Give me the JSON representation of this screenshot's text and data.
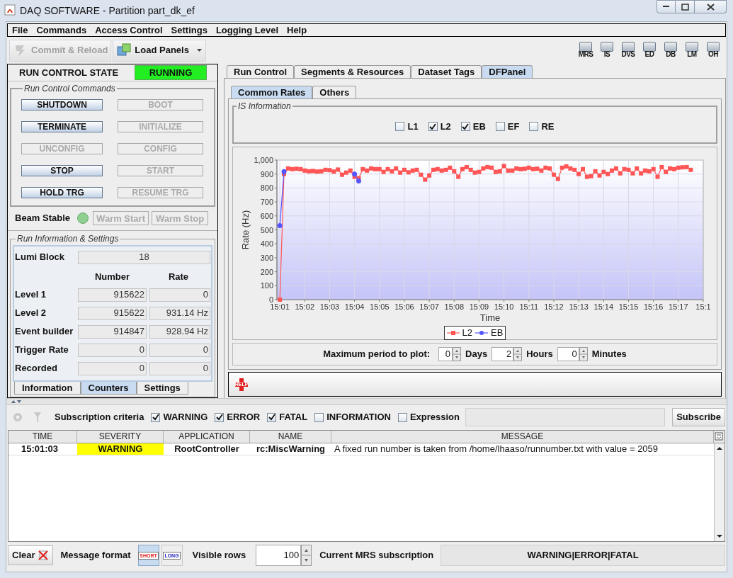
{
  "window": {
    "title": "DAQ SOFTWARE - Partition part_dk_ef"
  },
  "menu": [
    "File",
    "Commands",
    "Access Control",
    "Settings",
    "Logging Level",
    "Help"
  ],
  "toolbar": {
    "buttons": [
      {
        "label": "Commit & Reload",
        "disabled": true
      },
      {
        "label": "Load Panels",
        "disabled": false
      }
    ],
    "tools": [
      "MRS",
      "IS",
      "DVS",
      "ED",
      "DB",
      "LM",
      "OH"
    ]
  },
  "run_control": {
    "title": "RUN CONTROL STATE",
    "state": "RUNNING",
    "commands_title": "Run Control Commands",
    "commands": [
      {
        "label": "SHUTDOWN",
        "disabled": false
      },
      {
        "label": "BOOT",
        "disabled": true
      },
      {
        "label": "TERMINATE",
        "disabled": false
      },
      {
        "label": "INITIALIZE",
        "disabled": true
      },
      {
        "label": "UNCONFIG",
        "disabled": true
      },
      {
        "label": "CONFIG",
        "disabled": true
      },
      {
        "label": "STOP",
        "disabled": false
      },
      {
        "label": "START",
        "disabled": true
      },
      {
        "label": "HOLD TRG",
        "disabled": false
      },
      {
        "label": "RESUME TRG",
        "disabled": true
      }
    ],
    "beam_label": "Beam Stable",
    "beam_buttons": [
      {
        "label": "Warm Start",
        "disabled": true
      },
      {
        "label": "Warm Stop",
        "disabled": true
      }
    ]
  },
  "run_info": {
    "title": "Run Information & Settings",
    "lumi_label": "Lumi Block",
    "lumi": "18",
    "columns": [
      "Number",
      "Rate"
    ],
    "rows": [
      {
        "label": "Level 1",
        "number": "915622",
        "rate": "0"
      },
      {
        "label": "Level 2",
        "number": "915622",
        "rate": "931.14 Hz"
      },
      {
        "label": "Event builder",
        "number": "914847",
        "rate": "928.94 Hz"
      },
      {
        "label": "Trigger Rate",
        "number": "0",
        "rate": "0"
      },
      {
        "label": "Recorded",
        "number": "0",
        "rate": "0"
      }
    ],
    "tabs": [
      {
        "label": "Information",
        "selected": false
      },
      {
        "label": "Counters",
        "selected": true
      },
      {
        "label": "Settings",
        "selected": false
      }
    ]
  },
  "main_tabs": [
    {
      "label": "Run Control",
      "selected": false
    },
    {
      "label": "Segments & Resources",
      "selected": false
    },
    {
      "label": "Dataset Tags",
      "selected": false
    },
    {
      "label": "DFPanel",
      "selected": true
    }
  ],
  "sub_tabs": [
    {
      "label": "Common Rates",
      "selected": true
    },
    {
      "label": "Others",
      "selected": false
    }
  ],
  "is_info": {
    "title": "IS Information",
    "checks": [
      {
        "label": "L1",
        "checked": false
      },
      {
        "label": "L2",
        "checked": true
      },
      {
        "label": "EB",
        "checked": true
      },
      {
        "label": "EF",
        "checked": false
      },
      {
        "label": "RE",
        "checked": false
      }
    ]
  },
  "chart_data": {
    "type": "line",
    "xlabel": "Time",
    "ylabel": "Rate (Hz)",
    "categories": [
      "15:01",
      null,
      null,
      null,
      null,
      null,
      "15:02",
      null,
      null,
      null,
      null,
      null,
      "15:03",
      null,
      null,
      null,
      null,
      null,
      "15:04",
      null,
      null,
      null,
      null,
      null,
      "15:05",
      null,
      null,
      null,
      null,
      null,
      "15:06",
      null,
      null,
      null,
      null,
      null,
      "15:07",
      null,
      null,
      null,
      null,
      null,
      "15:08",
      null,
      null,
      null,
      null,
      null,
      "15:09",
      null,
      null,
      null,
      null,
      null,
      "15:10",
      null,
      null,
      null,
      null,
      null,
      "15:11",
      null,
      null,
      null,
      null,
      null,
      "15:12",
      null,
      null,
      null,
      null,
      null,
      "15:13",
      null,
      null,
      null,
      null,
      null,
      "15:14",
      null,
      null,
      null,
      null,
      null,
      "15:15",
      null,
      null,
      null,
      null,
      null,
      "15:16",
      null,
      null,
      null,
      null,
      null,
      "15:17",
      null,
      null,
      null,
      null,
      null,
      "15:1"
    ],
    "series": [
      {
        "name": "L2",
        "color": "#ff5555",
        "marker": "square",
        "values": [
          0,
          900,
          940,
          935,
          938,
          935,
          925,
          920,
          922,
          918,
          920,
          930,
          928,
          918,
          932,
          895,
          910,
          925,
          880,
          870,
          935,
          925,
          940,
          935,
          935,
          915,
          935,
          920,
          940,
          910,
          930,
          912,
          925,
          930,
          895,
          860,
          890,
          930,
          935,
          925,
          930,
          945,
          920,
          880,
          935,
          950,
          930,
          910,
          915,
          940,
          950,
          945,
          915,
          920,
          958,
          925,
          925,
          940,
          935,
          938,
          945,
          935,
          938,
          925,
          945,
          940,
          895,
          865,
          945,
          955,
          940,
          930,
          900,
          935,
          880,
          885,
          920,
          890,
          915,
          900,
          925,
          940,
          905,
          935,
          930,
          905,
          940,
          905,
          925,
          920,
          935,
          880,
          950,
          915,
          940,
          935,
          945,
          948,
          950,
          930,
          null,
          null,
          null
        ]
      },
      {
        "name": "EB",
        "color": "#5555ff",
        "marker": "circle",
        "values": [
          530,
          918,
          null,
          null,
          null,
          null,
          null,
          null,
          null,
          null,
          null,
          null,
          null,
          null,
          null,
          null,
          null,
          null,
          900,
          850,
          null,
          null,
          null,
          null,
          null,
          null,
          null,
          null,
          null,
          null,
          null,
          null,
          null,
          null,
          null,
          null,
          null,
          null,
          null,
          null,
          null,
          null,
          null,
          null,
          null,
          null,
          null,
          null,
          null,
          null,
          null,
          null,
          null,
          null,
          null,
          null,
          null,
          null,
          null,
          null,
          null,
          null,
          null,
          null,
          null,
          null,
          null,
          null,
          null,
          null,
          null,
          null,
          null,
          null,
          null,
          null,
          null,
          null,
          null,
          null,
          null,
          null,
          null,
          null,
          null,
          null,
          null,
          null,
          null,
          null,
          null,
          null,
          null,
          null,
          null,
          null,
          null,
          null,
          null,
          null,
          null,
          null,
          null
        ]
      }
    ],
    "ylim": [
      0,
      1000
    ],
    "grid": true,
    "legend": true,
    "yticks": [
      0,
      100,
      200,
      300,
      400,
      500,
      600,
      700,
      800,
      900,
      {
        "value": 1000,
        "label": "1,000"
      }
    ]
  },
  "period": {
    "label": "Maximum period to plot:",
    "fields": [
      {
        "value": "0",
        "unit": "Days"
      },
      {
        "value": "2",
        "unit": "Hours"
      },
      {
        "value": "0",
        "unit": "Minutes"
      }
    ]
  },
  "help": "HELP",
  "messages": {
    "criteria_label": "Subscription criteria",
    "filters": [
      {
        "label": "WARNING",
        "checked": true
      },
      {
        "label": "ERROR",
        "checked": true
      },
      {
        "label": "FATAL",
        "checked": true
      },
      {
        "label": "INFORMATION",
        "checked": false
      },
      {
        "label": "Expression",
        "checked": false
      }
    ],
    "subscribe": "Subscribe",
    "columns": [
      "TIME",
      "SEVERITY",
      "APPLICATION",
      "NAME",
      "MESSAGE"
    ],
    "rows": [
      {
        "time": "15:01:03",
        "severity": "WARNING",
        "color": "#ffff00",
        "application": "RootController",
        "name": "rc:MiscWarning",
        "message": "A fixed run number is taken from /home/lhaaso/runnumber.txt with value = 2059"
      }
    ]
  },
  "footer": {
    "clear": "Clear",
    "format_label": "Message format",
    "formats": [
      {
        "label": "SHORT",
        "selected": true
      },
      {
        "label": "LONG",
        "selected": false
      }
    ],
    "rows_label": "Visible rows",
    "rows_value": "100",
    "subscription_label": "Current MRS subscription",
    "subscription": "WARNING|ERROR|FATAL"
  }
}
